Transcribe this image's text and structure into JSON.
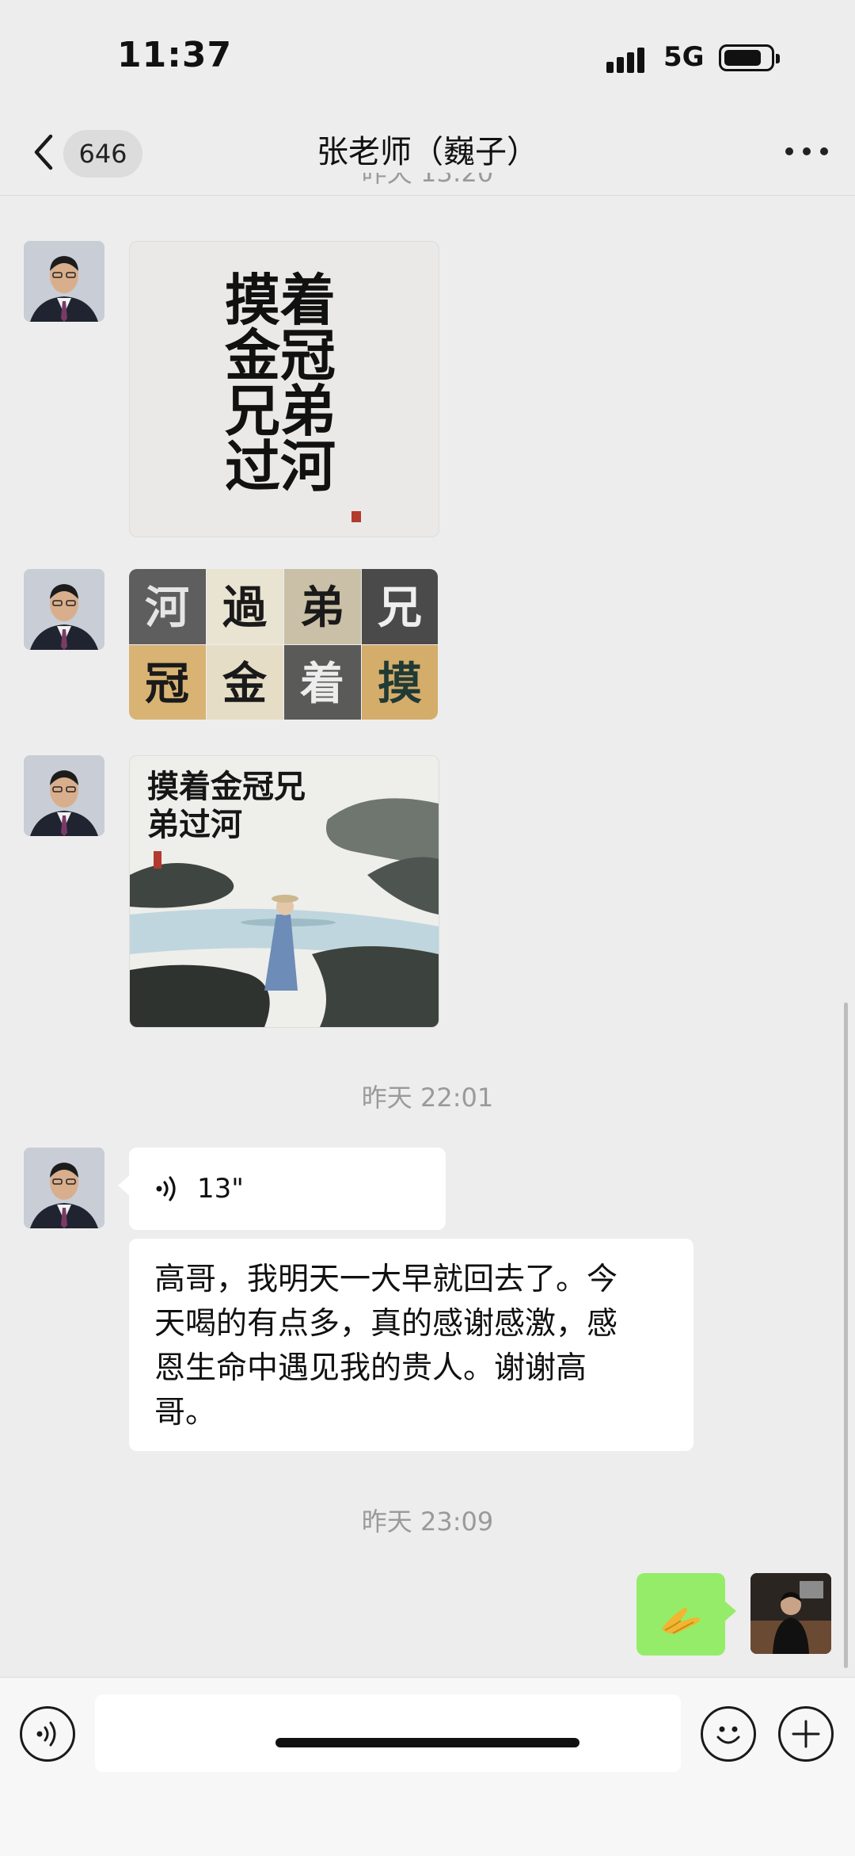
{
  "status_bar": {
    "time": "11:37",
    "network": "5G"
  },
  "nav": {
    "back_icon": "chevron-left-icon",
    "unread_count": "646",
    "title": "张老师（巍子）",
    "more_icon": "ellipsis-icon"
  },
  "messages": {
    "partial_timestamp": "昨天 13:20",
    "image1_text": [
      "摸着",
      "金冠",
      "兄弟",
      "过河"
    ],
    "image2_tiles": [
      "河",
      "過",
      "弟",
      "兄",
      "冠",
      "金",
      "着",
      "摸"
    ],
    "image3_text": [
      "摸着金冠兄",
      "弟过河"
    ],
    "timestamp1": "昨天 22:01",
    "voice_duration": "13\"",
    "text_lines": [
      "高哥，我明天一大早就回去了。今",
      "天喝的有点多，真的感谢感激，感",
      "恩生命中遇见我的贵人。谢谢高",
      "哥。"
    ],
    "timestamp2": "昨天 23:09",
    "sent_emoji": "folded-hands-icon"
  },
  "input_bar": {
    "voice_icon": "voice-icon",
    "emoji_icon": "smiley-icon",
    "plus_icon": "plus-icon"
  },
  "colors": {
    "background": "#EDEDED",
    "sent_bubble": "#95EC69",
    "received_bubble": "#FFFFFF",
    "timestamp": "#9A9A9A"
  }
}
